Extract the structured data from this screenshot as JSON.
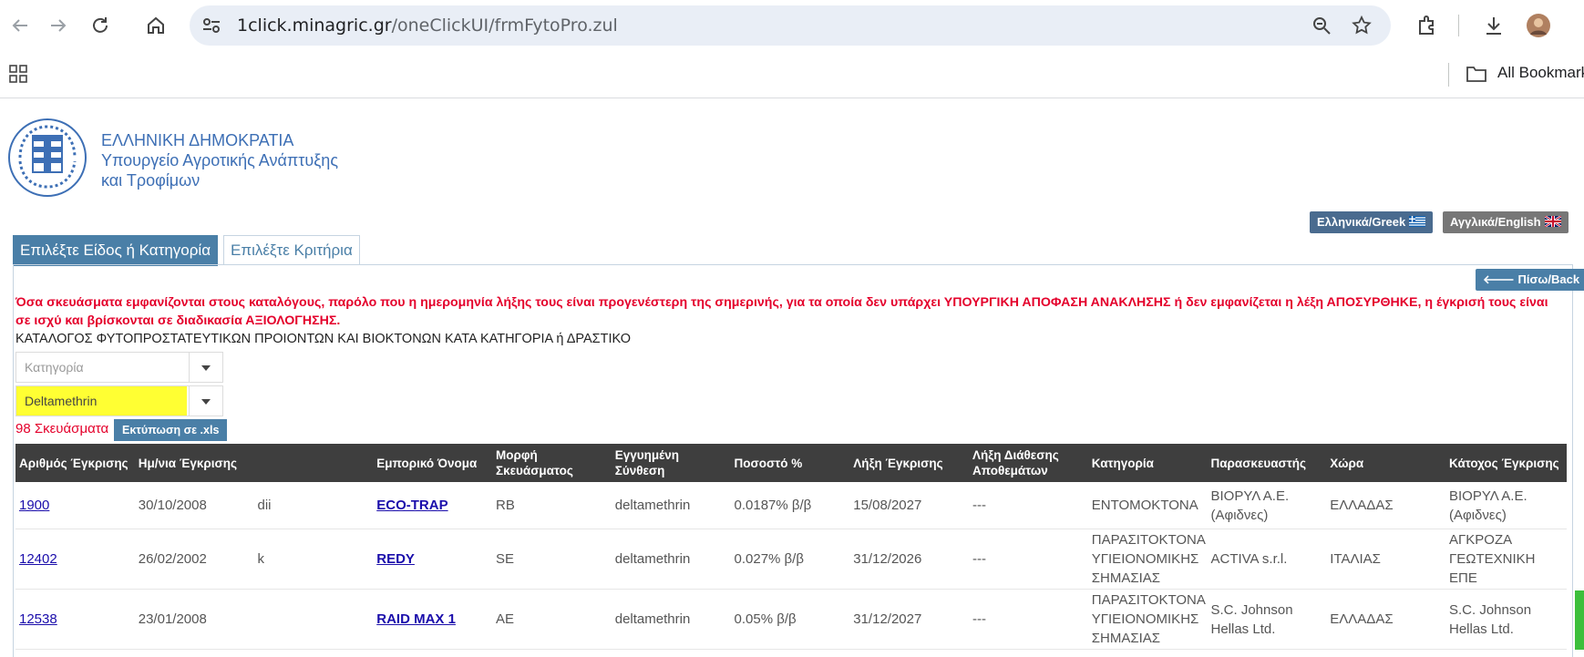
{
  "browser": {
    "url_host": "1click.minagric.gr",
    "url_path": "/oneClickUI/frmFytoPro.zul",
    "bookmarks_label": "All Bookmarks"
  },
  "header": {
    "org_line1": "ΕΛΛΗΝΙΚΗ ΔΗΜΟΚΡΑΤΙΑ",
    "org_line2": "Υπουργείο Αγροτικής Ανάπτυξης",
    "org_line3": "και Τροφίμων",
    "lang_greek": "Ελληνικά/Greek",
    "lang_english": "Αγγλικά/English"
  },
  "tabs": [
    {
      "label": "Επιλέξτε Είδος ή Κατηγορία"
    },
    {
      "label": "Επιλέξτε Κριτήρια"
    }
  ],
  "panel": {
    "back_label": "Πίσω/Back",
    "warning": "Όσα σκευάσματα εμφανίζονται στους καταλόγους, παρόλο που η ημερομηνία λήξης τους είναι προγενέστερη της σημερινής, για τα οποία δεν υπάρχει ΥΠΟΥΡΓΙΚΗ ΑΠΟΦΑΣΗ ΑΝΑΚΛΗΣΗΣ ή δεν εμφανίζεται η λέξη ΑΠΟΣΥΡΘΗΚΕ, η έγκρισή τους είναι σε ισχύ και βρίσκονται σε διαδικασία ΑΞΙΟΛΟΓΗΣΗΣ.",
    "catalog_title": "ΚΑΤΑΛΟΓΟΣ ΦΥΤΟΠΡΟΣΤΑΤΕΥΤΙΚΩΝ ΠΡΟΙΟΝΤΩΝ ΚΑΙ ΒΙΟΚΤΟΝΩΝ ΚΑΤΑ ΚΑΤΗΓΟΡΙΑ ή ΔΡΑΣΤΙΚΟ",
    "category_placeholder": "Κατηγορία",
    "substance_value": "Deltamethrin",
    "count_text": "98 Σκευάσματα",
    "export_label": "Εκτύπωση σε .xls"
  },
  "table": {
    "headers": [
      "Αριθμός Έγκρισης",
      "Ημ/νια Έγκρισης",
      "",
      "Εμπορικό Όνομα",
      "Μορφή Σκευάσματος",
      "Εγγυημένη Σύνθεση",
      "Ποσοστό %",
      "Λήξη Έγκρισης",
      "Λήξη Διάθεσης Αποθεμάτων",
      "Κατηγορία",
      "Παρασκευαστής",
      "Χώρα",
      "Κάτοχος Έγκρισης"
    ],
    "rows": [
      [
        "1900",
        "30/10/2008",
        "dii",
        "ECO-TRAP",
        "RB",
        "deltamethrin",
        "0.0187% β/β",
        "15/08/2027",
        "---",
        "ΕΝΤΟΜΟΚΤΟΝΑ",
        "ΒΙΟΡΥΛ Α.Ε. (Αφιδνες)",
        "ΕΛΛΑΔΑΣ",
        "ΒΙΟΡΥΛ Α.Ε. (Αφιδνες)"
      ],
      [
        "12402",
        "26/02/2002",
        "k",
        "REDY",
        "SE",
        "deltamethrin",
        "0.027% β/β",
        "31/12/2026",
        "---",
        "ΠΑΡΑΣΙΤΟΚΤΟΝΑ ΥΓΙΕΙΟΝΟΜΙΚΗΣ ΣΗΜΑΣΙΑΣ",
        "ACTIVA s.r.l.",
        "ΙΤΑΛΙΑΣ",
        "ΑΓΚΡΟΖΑ ΓΕΩΤΕΧΝΙΚΗ ΕΠΕ"
      ],
      [
        "12538",
        "23/01/2008",
        "",
        "RAID MAX 1",
        "AE",
        "deltamethrin",
        "0.05% β/β",
        "31/12/2027",
        "---",
        "ΠΑΡΑΣΙΤΟΚΤΟΝΑ ΥΓΙΕΙΟΝΟΜΙΚΗΣ ΣΗΜΑΣΙΑΣ",
        "S.C. Johnson Hellas Ltd.",
        "ΕΛΛΑΔΑΣ",
        "S.C. Johnson Hellas Ltd."
      ]
    ]
  }
}
